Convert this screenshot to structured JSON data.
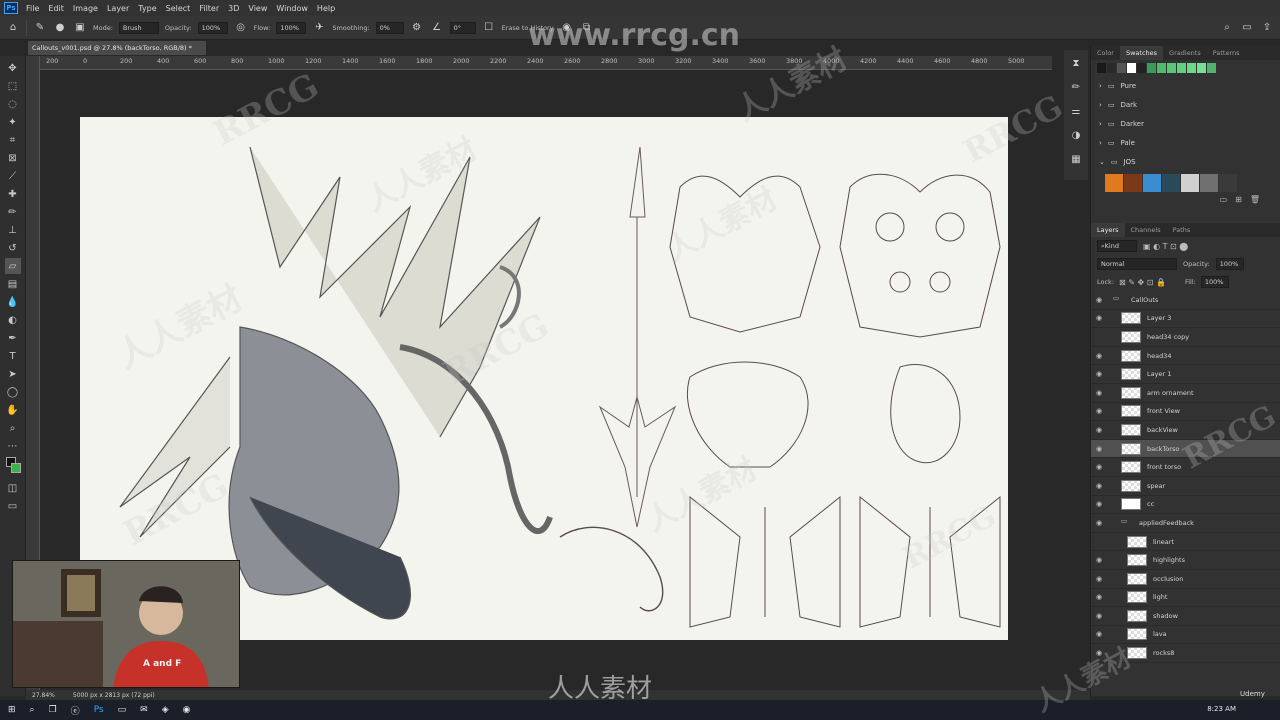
{
  "menu": {
    "items": [
      "File",
      "Edit",
      "Image",
      "Layer",
      "Type",
      "Select",
      "Filter",
      "3D",
      "View",
      "Window",
      "Help"
    ]
  },
  "options": {
    "mode_label": "Mode:",
    "mode_value": "Brush",
    "opacity_label": "Opacity:",
    "opacity_value": "100%",
    "flow_label": "Flow:",
    "flow_value": "100%",
    "smoothing_label": "Smoothing:",
    "smoothing_value": "0%",
    "angle_value": "0°",
    "erase_history": "Erase to History"
  },
  "document": {
    "tab_title": "Callouts_v001.psd @ 27.8% (backTorso, RGB/8) *"
  },
  "ruler": {
    "ticks": [
      "200",
      "0",
      "200",
      "400",
      "600",
      "800",
      "1000",
      "1200",
      "1400",
      "1600",
      "1800",
      "2000",
      "2200",
      "2400",
      "2600",
      "2800",
      "3000",
      "3200",
      "3400",
      "3600",
      "3800",
      "4000",
      "4200",
      "4400",
      "4600",
      "4800",
      "5000"
    ]
  },
  "swatches_panel": {
    "tabs": [
      "Color",
      "Swatches",
      "Gradients",
      "Patterns"
    ],
    "active_tab": "Swatches",
    "top_colors": [
      "#1a1a1a",
      "#2a2a2a",
      "#555555",
      "#ffffff",
      "#222222",
      "#3a9a5a",
      "#4cbb6c",
      "#58c878",
      "#62d080",
      "#6ed88a",
      "#7adf94",
      "#4fb46e"
    ],
    "folders": [
      "Pure",
      "Dark",
      "Darker",
      "Pale",
      "JOS"
    ],
    "jos_colors": [
      "#e07a1e",
      "#7a3a1a",
      "#3a8ed0",
      "#2a4a5a",
      "#d0d0d0",
      "#707070",
      "#3a3a3a"
    ]
  },
  "layers_panel": {
    "tabs": [
      "Layers",
      "Channels",
      "Paths"
    ],
    "active_tab": "Layers",
    "filter_kind": "Kind",
    "blend_mode": "Normal",
    "opacity_label": "Opacity:",
    "opacity_value": "100%",
    "lock_label": "Lock:",
    "fill_label": "Fill:",
    "fill_value": "100%",
    "layers": [
      {
        "name": "CallOuts",
        "type": "group",
        "visible": true
      },
      {
        "name": "Layer 3",
        "type": "layer",
        "visible": true
      },
      {
        "name": "head34 copy",
        "type": "layer",
        "visible": false
      },
      {
        "name": "head34",
        "type": "layer",
        "visible": true
      },
      {
        "name": "Layer 1",
        "type": "layer",
        "visible": true
      },
      {
        "name": "arm ornament",
        "type": "layer",
        "visible": true
      },
      {
        "name": "front View",
        "type": "layer",
        "visible": true
      },
      {
        "name": "backView",
        "type": "layer",
        "visible": true
      },
      {
        "name": "backTorso",
        "type": "layer",
        "visible": true,
        "selected": true
      },
      {
        "name": "front torso",
        "type": "layer",
        "visible": true
      },
      {
        "name": "spear",
        "type": "layer",
        "visible": true
      },
      {
        "name": "cc",
        "type": "adjustment",
        "visible": true
      },
      {
        "name": "appliedFeedback",
        "type": "group",
        "visible": true
      },
      {
        "name": "lineart",
        "type": "layer",
        "visible": false
      },
      {
        "name": "highlights",
        "type": "layer",
        "visible": true
      },
      {
        "name": "occlusion",
        "type": "layer",
        "visible": true
      },
      {
        "name": "light",
        "type": "layer",
        "visible": true
      },
      {
        "name": "shadow",
        "type": "layer",
        "visible": true
      },
      {
        "name": "lava",
        "type": "layer",
        "visible": true
      },
      {
        "name": "rocks8",
        "type": "layer",
        "visible": true
      }
    ]
  },
  "status": {
    "zoom": "27.84%",
    "doc_size": "5000 px x 2813 px (72 ppi)"
  },
  "taskbar": {
    "clock": "8:23 AM"
  },
  "webcam": {
    "shirt_text": "A and F"
  },
  "watermarks": {
    "site": "www.rrcg.cn",
    "brand": "RRCG",
    "cn": "人人素材",
    "bottom": "人人素材",
    "udemy": "Udemy"
  }
}
